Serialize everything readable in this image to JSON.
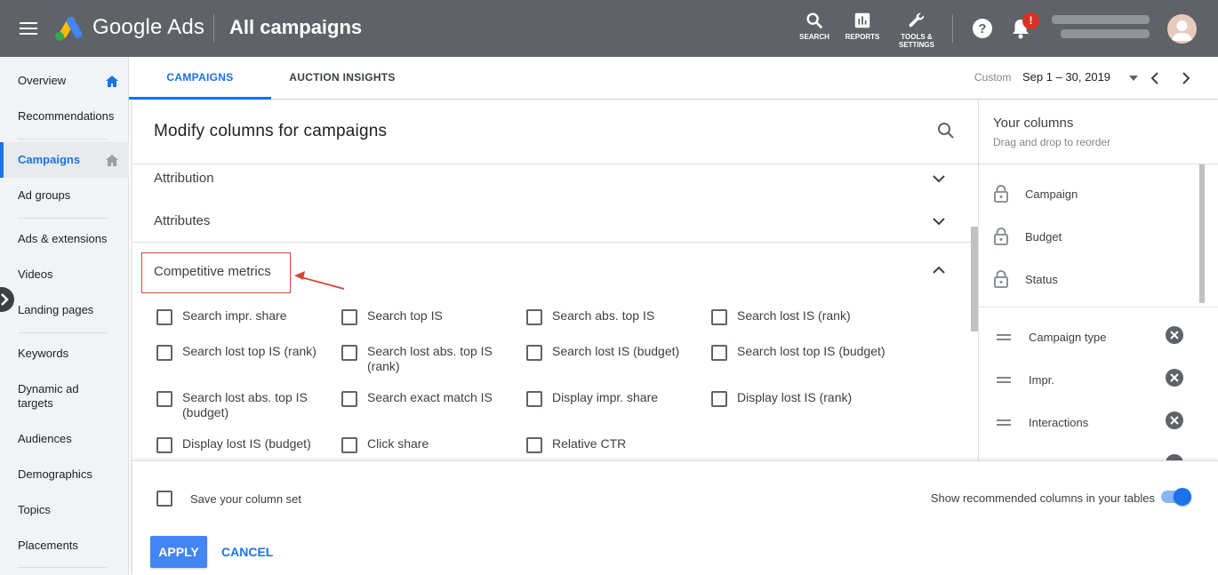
{
  "header": {
    "brand": "Google Ads",
    "title": "All campaigns",
    "tools": [
      {
        "label": "SEARCH",
        "icon": "search-icon"
      },
      {
        "label": "REPORTS",
        "icon": "reports-icon"
      },
      {
        "label_line1": "TOOLS &",
        "label_line2": "SETTINGS",
        "icon": "wrench-icon"
      }
    ],
    "notification_count": "!"
  },
  "sidebar": {
    "items": [
      {
        "label": "Overview"
      },
      {
        "label": "Recommendations"
      },
      {
        "label": "Campaigns"
      },
      {
        "label": "Ad groups"
      },
      {
        "label": "Ads & extensions"
      },
      {
        "label": "Videos"
      },
      {
        "label": "Landing pages"
      },
      {
        "label": "Keywords"
      },
      {
        "label": "Dynamic ad targets"
      },
      {
        "label": "Audiences"
      },
      {
        "label": "Demographics"
      },
      {
        "label": "Topics"
      },
      {
        "label": "Placements"
      }
    ]
  },
  "tabs": [
    {
      "label": "CAMPAIGNS"
    },
    {
      "label": "AUCTION INSIGHTS"
    }
  ],
  "date_range": {
    "label": "Custom",
    "value": "Sep 1 – 30, 2019"
  },
  "modal": {
    "title": "Modify columns for campaigns",
    "sections": [
      {
        "label": "Attribution"
      },
      {
        "label": "Attributes"
      },
      {
        "label": "Competitive metrics"
      }
    ],
    "metrics": [
      "Search impr. share",
      "Search top IS",
      "Search abs. top IS",
      "Search lost IS (rank)",
      "Search lost top IS (rank)",
      "Search lost abs. top IS (rank)",
      "Search lost IS (budget)",
      "Search lost top IS (budget)",
      "Search lost abs. top IS (budget)",
      "Search exact match IS",
      "Display impr. share",
      "Display lost IS (rank)",
      "Display lost IS (budget)",
      "Click share",
      "Relative CTR"
    ]
  },
  "your_columns": {
    "title": "Your columns",
    "subtitle": "Drag and drop to reorder",
    "locked": [
      "Campaign",
      "Budget",
      "Status"
    ],
    "movable": [
      "Campaign type",
      "Impr.",
      "Interactions"
    ]
  },
  "footer": {
    "save_label": "Save your column set",
    "show_recommended": "Show recommended columns in your tables",
    "toggle_on": true,
    "apply_label": "APPLY",
    "cancel_label": "CANCEL"
  },
  "colors": {
    "accent": "#1a73e8",
    "header_bg": "#5f6368",
    "highlight": "#d34836"
  }
}
